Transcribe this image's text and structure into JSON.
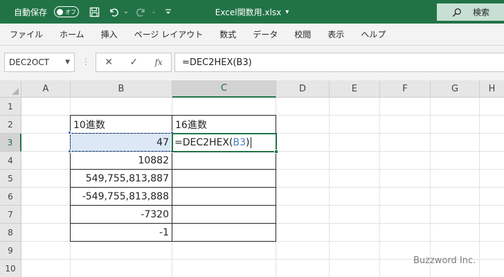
{
  "titlebar": {
    "autosave_label": "自動保存",
    "autosave_state": "オフ",
    "filename": "Excel関数用.xlsx",
    "filename_arrow": "▾",
    "search_label": "検索",
    "background": "#217346"
  },
  "menu": {
    "items": [
      "ファイル",
      "ホーム",
      "挿入",
      "ページ レイアウト",
      "数式",
      "データ",
      "校閲",
      "表示",
      "ヘルプ"
    ]
  },
  "formula_bar": {
    "name_box": "DEC2OCT",
    "fx_label": "fx",
    "formula": "=DEC2HEX(B3)"
  },
  "grid": {
    "columns": [
      "A",
      "B",
      "C",
      "D",
      "E",
      "F",
      "G",
      "H"
    ],
    "rows": [
      "1",
      "2",
      "3",
      "4",
      "5",
      "6",
      "7",
      "8",
      "9",
      "10"
    ],
    "selected_column": "C",
    "selected_row": "3"
  },
  "table": {
    "header_b": "10進数",
    "header_c": "16進数",
    "values": [
      "47",
      "10882",
      "549,755,813,887",
      "-549,755,813,888",
      "-7320",
      "-1"
    ],
    "edit_prefix": "=DEC2HEX(",
    "edit_ref": "B3",
    "edit_suffix": ")"
  },
  "watermark": "Buzzword Inc.",
  "colors": {
    "accent": "#217346",
    "reference": "#4a7bbf",
    "ref_fill": "#dce8f5"
  }
}
